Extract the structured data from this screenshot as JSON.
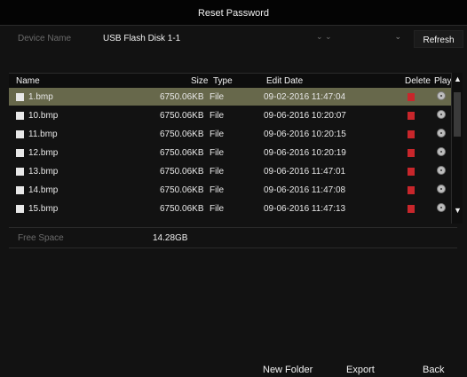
{
  "window": {
    "title": "Reset Password"
  },
  "device": {
    "label": "Device Name",
    "selected": "USB Flash Disk 1-1",
    "refresh_label": "Refresh"
  },
  "table": {
    "headers": {
      "name": "Name",
      "size": "Size",
      "type": "Type",
      "edit_date": "Edit Date",
      "delete": "Delete",
      "play": "Play"
    },
    "rows": [
      {
        "name": "1.bmp",
        "size": "6750.06KB",
        "type": "File",
        "date": "09-02-2016 11:47:04",
        "selected": true
      },
      {
        "name": "10.bmp",
        "size": "6750.06KB",
        "type": "File",
        "date": "09-06-2016 10:20:07",
        "selected": false
      },
      {
        "name": "11.bmp",
        "size": "6750.06KB",
        "type": "File",
        "date": "09-06-2016 10:20:15",
        "selected": false
      },
      {
        "name": "12.bmp",
        "size": "6750.06KB",
        "type": "File",
        "date": "09-06-2016 10:20:19",
        "selected": false
      },
      {
        "name": "13.bmp",
        "size": "6750.06KB",
        "type": "File",
        "date": "09-06-2016 11:47:01",
        "selected": false
      },
      {
        "name": "14.bmp",
        "size": "6750.06KB",
        "type": "File",
        "date": "09-06-2016 11:47:08",
        "selected": false
      },
      {
        "name": "15.bmp",
        "size": "6750.06KB",
        "type": "File",
        "date": "09-06-2016 11:47:13",
        "selected": false
      }
    ]
  },
  "free_space": {
    "label": "Free Space",
    "value": "14.28GB"
  },
  "footer": {
    "new_folder": "New Folder",
    "export": "Export",
    "back": "Back"
  },
  "colors": {
    "selected_row": "#67684b",
    "delete_icon": "#c8262b"
  }
}
